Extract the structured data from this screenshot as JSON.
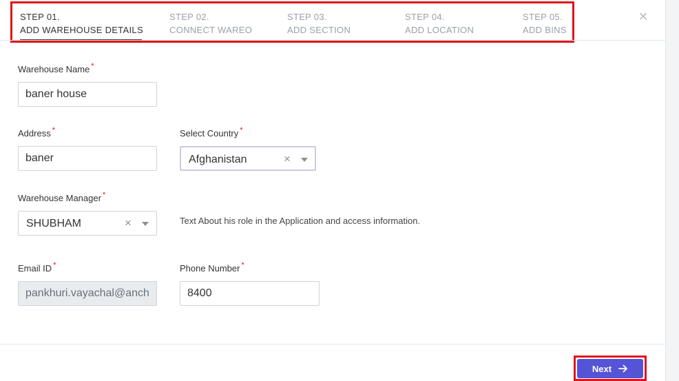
{
  "steps": [
    {
      "num": "STEP 01.",
      "label": "ADD WAREHOUSE DETAILS",
      "active": true
    },
    {
      "num": "STEP 02.",
      "label": "CONNECT WAREO",
      "active": false
    },
    {
      "num": "STEP 03.",
      "label": "ADD SECTION",
      "active": false
    },
    {
      "num": "STEP 04.",
      "label": "ADD LOCATION",
      "active": false
    },
    {
      "num": "STEP 05.",
      "label": "ADD BINS",
      "active": false
    }
  ],
  "close_glyph": "×",
  "form": {
    "warehouse_name": {
      "label": "Warehouse Name",
      "required": "*",
      "value": "baner house"
    },
    "address": {
      "label": "Address",
      "required": "*",
      "value": "baner"
    },
    "country": {
      "label": "Select Country",
      "required": "*",
      "value": "Afghanistan"
    },
    "manager": {
      "label": "Warehouse Manager",
      "required": "*",
      "value": "SHUBHAM",
      "help": "Text About his role in the Application and access information."
    },
    "email": {
      "label": "Email ID",
      "required": "*",
      "value": "pankhuri.vayachal@anch"
    },
    "phone": {
      "label": "Phone Number",
      "required": "*",
      "value": "8400"
    }
  },
  "clear_glyph": "×",
  "next_button": {
    "label": "Next",
    "icon": "arrow-right-icon"
  },
  "colors": {
    "accent": "#5553d6",
    "highlight": "#e0111b",
    "required": "#e0111b"
  }
}
